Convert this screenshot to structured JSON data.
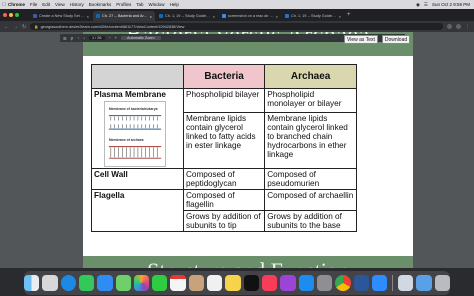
{
  "menubar": {
    "app": "Chrome",
    "items": [
      "File",
      "Edit",
      "View",
      "History",
      "Bookmarks",
      "Profiles",
      "Tab",
      "Window",
      "Help"
    ],
    "clock": "Sun Oct 2  9:59 PM"
  },
  "tabs": [
    {
      "title": "Create a New Study Set | Qui...",
      "color": "#4257b2"
    },
    {
      "title": "Ch. 27 -- Bacteria and Archae...",
      "color": "#0f6ab4"
    },
    {
      "title": "Ch. 1, 19 -- Study Guide - Fall...",
      "color": "#0f6ab4"
    },
    {
      "title": "screenshot on a mac air - Go...",
      "color": "#4285f4"
    },
    {
      "title": "Ch. 1, 19 -- Study Guide - Go...",
      "color": "#1a73e8"
    }
  ],
  "address": {
    "url": "georgiasouthern.desire2learn.com/d2l/le/content/661177/viewContent/10942838/View"
  },
  "pdf": {
    "page_indicator": "1 / 26",
    "zoom": "Automatic Zoom",
    "view_as_text": "View as Text",
    "download": "Download"
  },
  "slide": {
    "title": "Bacteria versus Archaea",
    "next_title": "Structure and Function",
    "table": {
      "headers": [
        "Bacteria",
        "Archaea"
      ],
      "rows": [
        {
          "label": "Plasma Membrane",
          "bacteria": "Phospholipid bilayer",
          "archaea": "Phospholipid monolayer or bilayer"
        },
        {
          "label": "",
          "bacteria": "Membrane lipids contain glycerol linked to fatty acids in ester linkage",
          "archaea": "Membrane lipids contain glycerol linked to branched chain hydrocarbons in ether linkage"
        },
        {
          "label": "Cell Wall",
          "bacteria": "Composed of peptidoglycan",
          "archaea": "Composed of pseudomurien"
        },
        {
          "label": "Flagella",
          "bacteria": "Composed of flagellin",
          "archaea": "Composed of archaellin"
        },
        {
          "label": "",
          "bacteria": "Grows by addition of subunits to tip",
          "archaea": "Grows by addition of subunits to the base"
        }
      ]
    },
    "diagram_labels": [
      "Membrane of bacteria/eukarya",
      "Membrane of archaea"
    ]
  },
  "colors": {
    "banner": "#6b8f6b",
    "bacteria_header": "#f0c6cc",
    "archaea_header": "#d9d7ad"
  },
  "dock_icons": [
    "finder",
    "launchpad",
    "safari",
    "messages",
    "mail",
    "maps",
    "photos",
    "facetime",
    "calendar",
    "contacts",
    "reminders",
    "notes",
    "tv",
    "music",
    "podcasts",
    "app-store",
    "settings",
    "chrome",
    "word",
    "zoom",
    "preview",
    "downloads",
    "trash"
  ]
}
